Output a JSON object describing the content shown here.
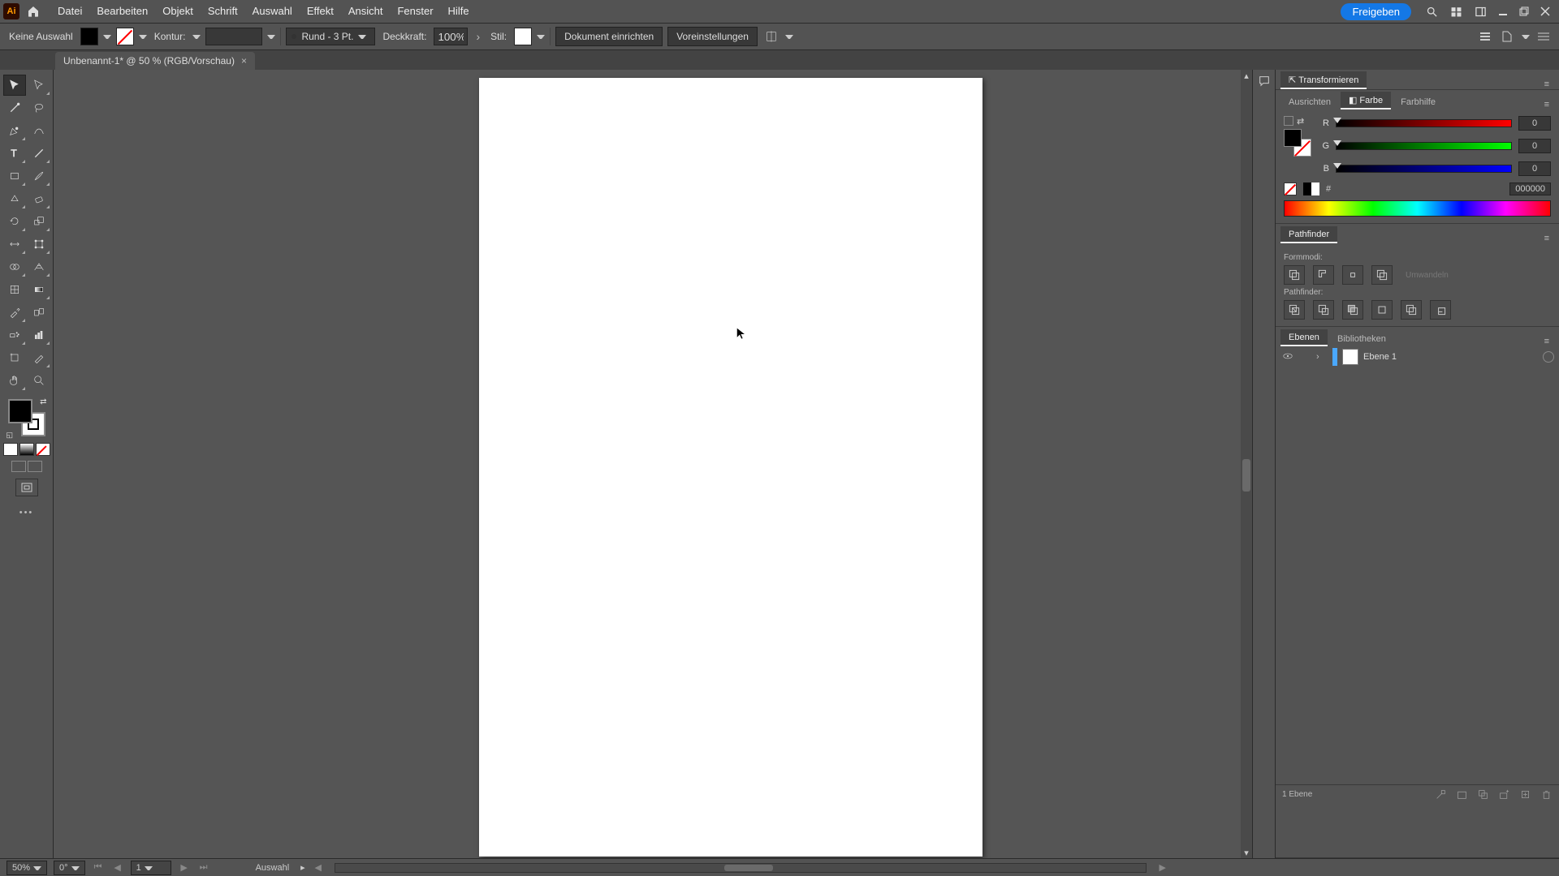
{
  "menubar": {
    "logo_text": "Ai",
    "items": [
      "Datei",
      "Bearbeiten",
      "Objekt",
      "Schrift",
      "Auswahl",
      "Effekt",
      "Ansicht",
      "Fenster",
      "Hilfe"
    ],
    "share_label": "Freigeben"
  },
  "controlbar": {
    "selection_label": "Keine Auswahl",
    "kontur_label": "Kontur:",
    "stroke_weight": "",
    "brush_value": "Rund - 3 Pt.",
    "opacity_label": "Deckkraft:",
    "opacity_value": "100%",
    "style_label": "Stil:",
    "doc_setup": "Dokument einrichten",
    "preferences": "Voreinstellungen"
  },
  "doc_tab": {
    "title": "Unbenannt-1* @ 50 % (RGB/Vorschau)",
    "close": "×"
  },
  "panels": {
    "transform_tab": "Transformieren",
    "align_tab": "Ausrichten",
    "color_tab": "Farbe",
    "colorguide_tab": "Farbhilfe",
    "color": {
      "r_label": "R",
      "r_value": "0",
      "g_label": "G",
      "g_value": "0",
      "b_label": "B",
      "b_value": "0",
      "hex_prefix": "#",
      "hex_value": "000000"
    },
    "pathfinder_tab": "Pathfinder",
    "pf_shapemodes_label": "Formmodi:",
    "pf_expand": "Umwandeln",
    "pf_pathfinder_label": "Pathfinder:",
    "layers_tab": "Ebenen",
    "libraries_tab": "Bibliotheken",
    "layer1_name": "Ebene 1",
    "layers_count": "1 Ebene"
  },
  "statusbar": {
    "zoom": "50%",
    "rotation": "0°",
    "artboard_num": "1",
    "tool": "Auswahl"
  },
  "cursor_pos": "688,308"
}
